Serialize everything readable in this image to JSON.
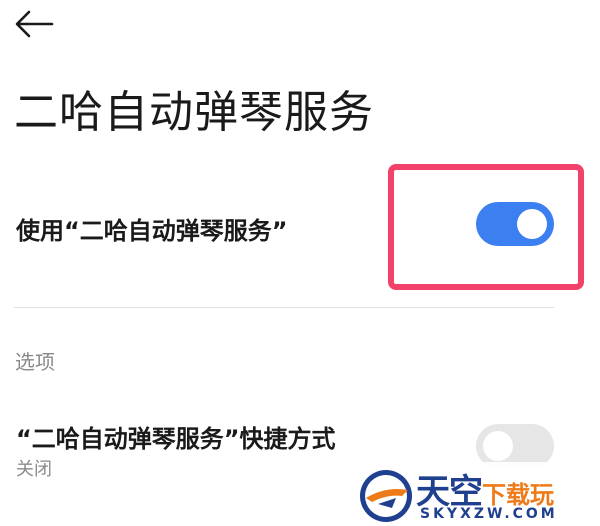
{
  "header": {
    "back_icon": "arrow-left-icon",
    "title": "二哈自动弹琴服务"
  },
  "service_setting": {
    "label": "使用“二哈自动弹琴服务”",
    "toggle_state": "on"
  },
  "options_section": {
    "header": "选项",
    "shortcut": {
      "label": "“二哈自动弹琴服务”快捷方式",
      "status": "关闭",
      "toggle_state": "off"
    }
  },
  "watermark": {
    "title_big": "天空",
    "title_small": "下载玩",
    "domain": "SKYXZW.COM"
  },
  "colors": {
    "toggle_on": "#3b7ff0",
    "toggle_off": "#e6e6e6",
    "highlight": "#f2426a"
  }
}
